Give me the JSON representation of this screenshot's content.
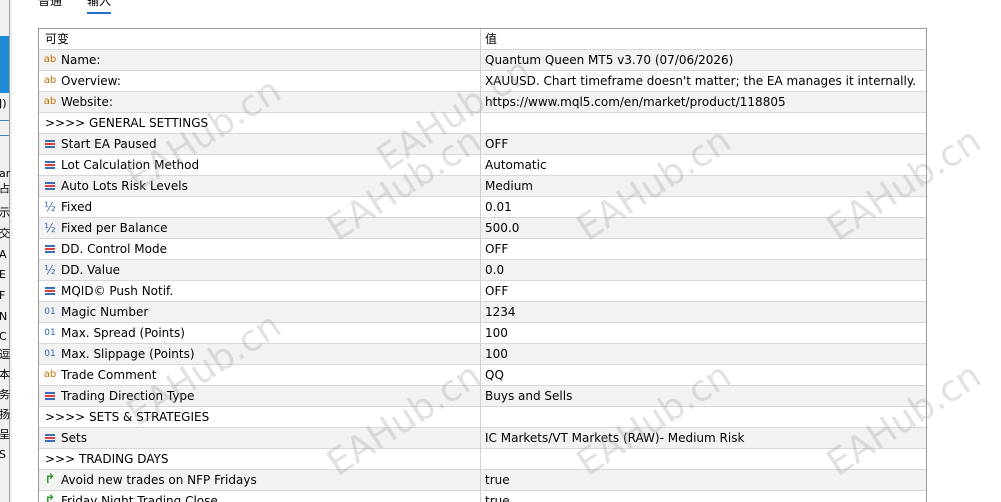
{
  "left_strip": {
    "chars": [
      "J)",
      "ar",
      "占",
      "示",
      "交",
      "A",
      "E",
      "F",
      "N",
      "C",
      "逗",
      "本",
      "务",
      "扬",
      "呈",
      "S"
    ]
  },
  "tabs": [
    {
      "label": "普通"
    },
    {
      "label": "输入"
    }
  ],
  "table": {
    "header": {
      "variable": "可变",
      "value": "值"
    },
    "rows": [
      {
        "icon": "ab-string-icon",
        "glyph": "ab",
        "name": "Name:",
        "value": "Quantum Queen MT5 v3.70 (07/06/2026)"
      },
      {
        "icon": "ab-string-icon",
        "glyph": "ab",
        "name": "Overview:",
        "value": "XAUUSD. Chart timeframe doesn't matter; the EA manages it internally."
      },
      {
        "icon": "ab-string-icon",
        "glyph": "ab",
        "name": "Website:",
        "value": "https://www.mql5.com/en/market/product/118805"
      },
      {
        "icon": "none",
        "glyph": "",
        "name": ">>>> GENERAL SETTINGS",
        "value": "",
        "section": true
      },
      {
        "icon": "enum-icon",
        "glyph": "",
        "name": "Start EA Paused",
        "value": "OFF"
      },
      {
        "icon": "enum-icon",
        "glyph": "",
        "name": "Lot Calculation Method",
        "value": "Automatic"
      },
      {
        "icon": "enum-icon",
        "glyph": "",
        "name": "Auto Lots Risk Levels",
        "value": "Medium"
      },
      {
        "icon": "double-icon",
        "glyph": "½",
        "name": "Fixed",
        "value": "0.01"
      },
      {
        "icon": "double-icon",
        "glyph": "½",
        "name": "Fixed per Balance",
        "value": "500.0"
      },
      {
        "icon": "enum-icon",
        "glyph": "",
        "name": "DD. Control Mode",
        "value": "OFF"
      },
      {
        "icon": "double-icon",
        "glyph": "½",
        "name": "DD. Value",
        "value": "0.0"
      },
      {
        "icon": "enum-icon",
        "glyph": "",
        "name": "MQID© Push Notif.",
        "value": "OFF"
      },
      {
        "icon": "int-icon",
        "glyph": "01",
        "name": "Magic Number",
        "value": "1234"
      },
      {
        "icon": "int-icon",
        "glyph": "01",
        "name": "Max. Spread (Points)",
        "value": "100"
      },
      {
        "icon": "int-icon",
        "glyph": "01",
        "name": "Max. Slippage (Points)",
        "value": "100"
      },
      {
        "icon": "ab-string-icon",
        "glyph": "ab",
        "name": "Trade Comment",
        "value": "QQ"
      },
      {
        "icon": "enum-icon",
        "glyph": "",
        "name": "Trading Direction Type",
        "value": "Buys and Sells"
      },
      {
        "icon": "none",
        "glyph": "",
        "name": ">>>> SETS & STRATEGIES",
        "value": "",
        "section": true
      },
      {
        "icon": "enum-icon",
        "glyph": "",
        "name": "Sets",
        "value": "IC Markets/VT Markets (RAW)- Medium Risk"
      },
      {
        "icon": "none",
        "glyph": "",
        "name": ">>> TRADING DAYS",
        "value": "",
        "section": true
      },
      {
        "icon": "bool-icon",
        "glyph": "↱",
        "name": "Avoid new trades on NFP Fridays",
        "value": "true"
      },
      {
        "icon": "bool-icon",
        "glyph": "↱",
        "name": "Friday Night Trading Close",
        "value": "true"
      }
    ]
  },
  "watermark": "EAHub.cn"
}
